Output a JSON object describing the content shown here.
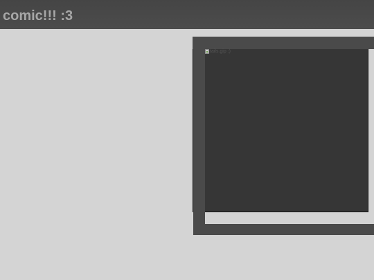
{
  "header": {
    "title": "comic!!! :3"
  },
  "comic": {
    "image_alt": "tails.gip :)",
    "icon": "broken-image-icon"
  },
  "colors": {
    "background": "#d4d4d4",
    "header": "#4a4a4a",
    "title_text": "#a7a7a7",
    "frame": "#4a4a4a",
    "panel": "#363636"
  }
}
